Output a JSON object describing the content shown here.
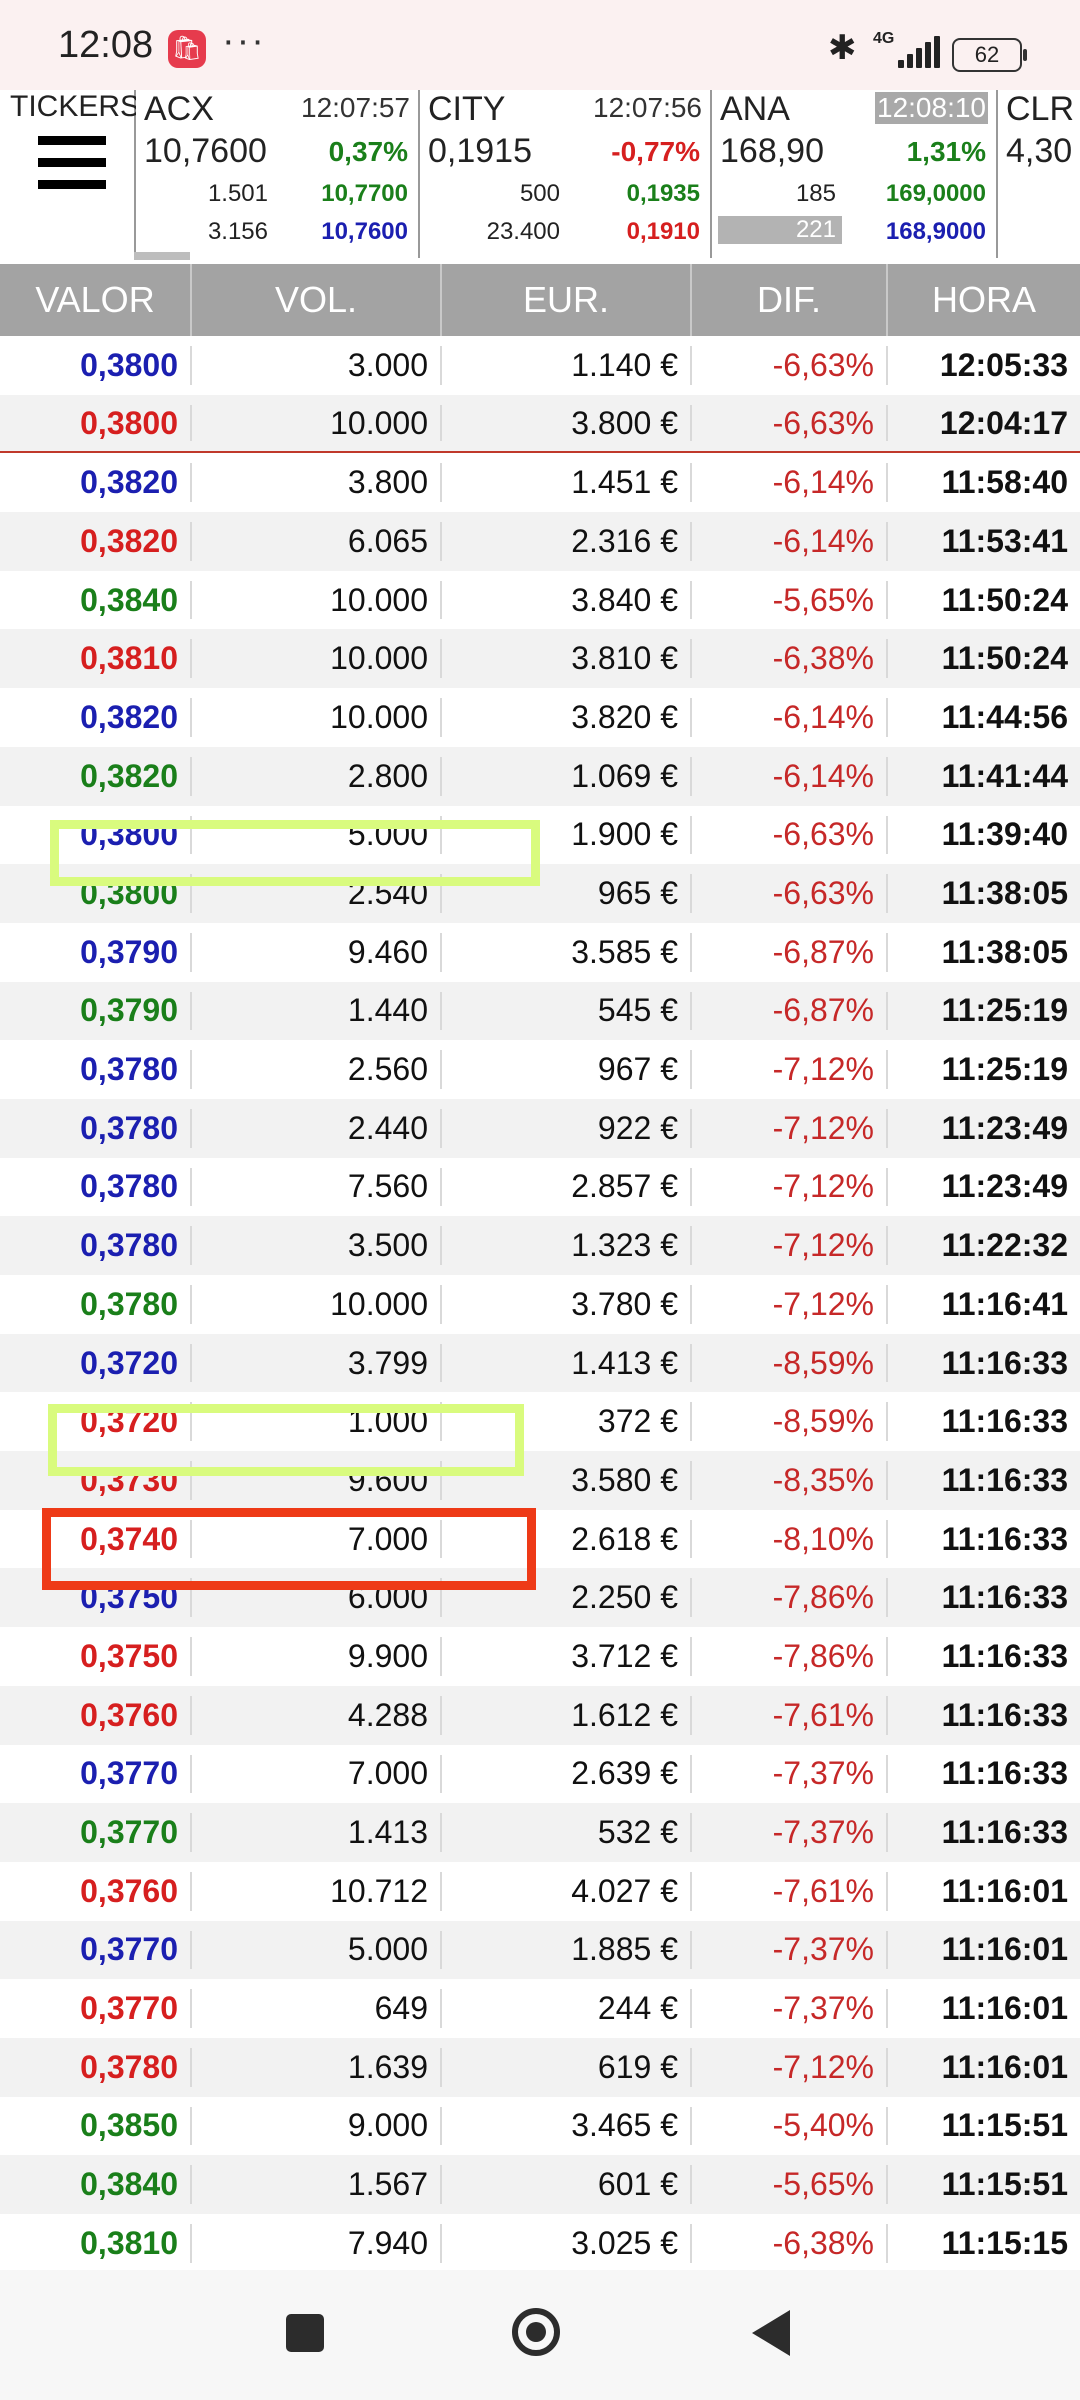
{
  "status": {
    "time": "12:08",
    "more": "···",
    "network": "4G",
    "battery": "62"
  },
  "tickers": {
    "label": "TICKERS",
    "cards": [
      {
        "symbol": "ACX",
        "time": "12:07:57",
        "price": "10,7600",
        "pct": "0,37%",
        "pct_color": "green",
        "bid_qty": "1.501",
        "bid_price": "10,7700",
        "ask_qty": "3.156",
        "ask_price": "10,7600"
      },
      {
        "symbol": "CITY",
        "time": "12:07:56",
        "price": "0,1915",
        "pct": "-0,77%",
        "pct_color": "red",
        "bid_qty": "500",
        "bid_price": "0,1935",
        "ask_qty": "23.400",
        "ask_price": "0,1910"
      },
      {
        "symbol": "ANA",
        "time": "12:08:10",
        "price": "168,90",
        "pct": "1,31%",
        "pct_color": "green",
        "bid_qty": "185",
        "bid_price": "169,0000",
        "ask_qty": "221",
        "ask_price": "168,9000"
      },
      {
        "symbol": "CLR",
        "price": "4,30"
      }
    ]
  },
  "table": {
    "headers": [
      "VALOR",
      "VOL.",
      "EUR.",
      "DIF.",
      "HORA"
    ],
    "rows": [
      {
        "valor": "0,3800",
        "color": "blue",
        "vol": "3.000",
        "eur": "1.140 €",
        "dif": "-6,63%",
        "hora": "12:05:33"
      },
      {
        "valor": "0,3800",
        "color": "red",
        "vol": "10.000",
        "eur": "3.800 €",
        "dif": "-6,63%",
        "hora": "12:04:17"
      },
      {
        "valor": "0,3820",
        "color": "blue",
        "vol": "3.800",
        "eur": "1.451 €",
        "dif": "-6,14%",
        "hora": "11:58:40"
      },
      {
        "valor": "0,3820",
        "color": "red",
        "vol": "6.065",
        "eur": "2.316 €",
        "dif": "-6,14%",
        "hora": "11:53:41"
      },
      {
        "valor": "0,3840",
        "color": "green",
        "vol": "10.000",
        "eur": "3.840 €",
        "dif": "-5,65%",
        "hora": "11:50:24"
      },
      {
        "valor": "0,3810",
        "color": "red",
        "vol": "10.000",
        "eur": "3.810 €",
        "dif": "-6,38%",
        "hora": "11:50:24"
      },
      {
        "valor": "0,3820",
        "color": "blue",
        "vol": "10.000",
        "eur": "3.820 €",
        "dif": "-6,14%",
        "hora": "11:44:56"
      },
      {
        "valor": "0,3820",
        "color": "green",
        "vol": "2.800",
        "eur": "1.069 €",
        "dif": "-6,14%",
        "hora": "11:41:44"
      },
      {
        "valor": "0,3800",
        "color": "blue",
        "vol": "5.000",
        "eur": "1.900 €",
        "dif": "-6,63%",
        "hora": "11:39:40"
      },
      {
        "valor": "0,3800",
        "color": "green",
        "vol": "2.540",
        "eur": "965 €",
        "dif": "-6,63%",
        "hora": "11:38:05"
      },
      {
        "valor": "0,3790",
        "color": "blue",
        "vol": "9.460",
        "eur": "3.585 €",
        "dif": "-6,87%",
        "hora": "11:38:05"
      },
      {
        "valor": "0,3790",
        "color": "green",
        "vol": "1.440",
        "eur": "545 €",
        "dif": "-6,87%",
        "hora": "11:25:19"
      },
      {
        "valor": "0,3780",
        "color": "blue",
        "vol": "2.560",
        "eur": "967 €",
        "dif": "-7,12%",
        "hora": "11:25:19"
      },
      {
        "valor": "0,3780",
        "color": "blue",
        "vol": "2.440",
        "eur": "922 €",
        "dif": "-7,12%",
        "hora": "11:23:49"
      },
      {
        "valor": "0,3780",
        "color": "blue",
        "vol": "7.560",
        "eur": "2.857 €",
        "dif": "-7,12%",
        "hora": "11:23:49"
      },
      {
        "valor": "0,3780",
        "color": "blue",
        "vol": "3.500",
        "eur": "1.323 €",
        "dif": "-7,12%",
        "hora": "11:22:32"
      },
      {
        "valor": "0,3780",
        "color": "green",
        "vol": "10.000",
        "eur": "3.780 €",
        "dif": "-7,12%",
        "hora": "11:16:41"
      },
      {
        "valor": "0,3720",
        "color": "blue",
        "vol": "3.799",
        "eur": "1.413 €",
        "dif": "-8,59%",
        "hora": "11:16:33"
      },
      {
        "valor": "0,3720",
        "color": "red",
        "vol": "1.000",
        "eur": "372 €",
        "dif": "-8,59%",
        "hora": "11:16:33"
      },
      {
        "valor": "0,3730",
        "color": "red",
        "vol": "9.600",
        "eur": "3.580 €",
        "dif": "-8,35%",
        "hora": "11:16:33"
      },
      {
        "valor": "0,3740",
        "color": "red",
        "vol": "7.000",
        "eur": "2.618 €",
        "dif": "-8,10%",
        "hora": "11:16:33"
      },
      {
        "valor": "0,3750",
        "color": "blue",
        "vol": "6.000",
        "eur": "2.250 €",
        "dif": "-7,86%",
        "hora": "11:16:33"
      },
      {
        "valor": "0,3750",
        "color": "red",
        "vol": "9.900",
        "eur": "3.712 €",
        "dif": "-7,86%",
        "hora": "11:16:33"
      },
      {
        "valor": "0,3760",
        "color": "red",
        "vol": "4.288",
        "eur": "1.612 €",
        "dif": "-7,61%",
        "hora": "11:16:33"
      },
      {
        "valor": "0,3770",
        "color": "blue",
        "vol": "7.000",
        "eur": "2.639 €",
        "dif": "-7,37%",
        "hora": "11:16:33"
      },
      {
        "valor": "0,3770",
        "color": "green",
        "vol": "1.413",
        "eur": "532 €",
        "dif": "-7,37%",
        "hora": "11:16:33"
      },
      {
        "valor": "0,3760",
        "color": "red",
        "vol": "10.712",
        "eur": "4.027 €",
        "dif": "-7,61%",
        "hora": "11:16:01"
      },
      {
        "valor": "0,3770",
        "color": "blue",
        "vol": "5.000",
        "eur": "1.885 €",
        "dif": "-7,37%",
        "hora": "11:16:01"
      },
      {
        "valor": "0,3770",
        "color": "red",
        "vol": "649",
        "eur": "244 €",
        "dif": "-7,37%",
        "hora": "11:16:01"
      },
      {
        "valor": "0,3780",
        "color": "red",
        "vol": "1.639",
        "eur": "619 €",
        "dif": "-7,12%",
        "hora": "11:16:01"
      },
      {
        "valor": "0,3850",
        "color": "green",
        "vol": "9.000",
        "eur": "3.465 €",
        "dif": "-5,40%",
        "hora": "11:15:51"
      },
      {
        "valor": "0,3840",
        "color": "green",
        "vol": "1.567",
        "eur": "601 €",
        "dif": "-5,65%",
        "hora": "11:15:51"
      },
      {
        "valor": "0,3810",
        "color": "green",
        "vol": "7.940",
        "eur": "3.025 €",
        "dif": "-6,38%",
        "hora": "11:15:15"
      }
    ]
  },
  "colors": {
    "blue": "#1b1fb0",
    "red": "#d61f1f",
    "green": "#1a7f1a",
    "header_bg": "#a3a3a3",
    "highlight_yellow": "#d9fb7e",
    "highlight_red": "#ee3a17"
  }
}
